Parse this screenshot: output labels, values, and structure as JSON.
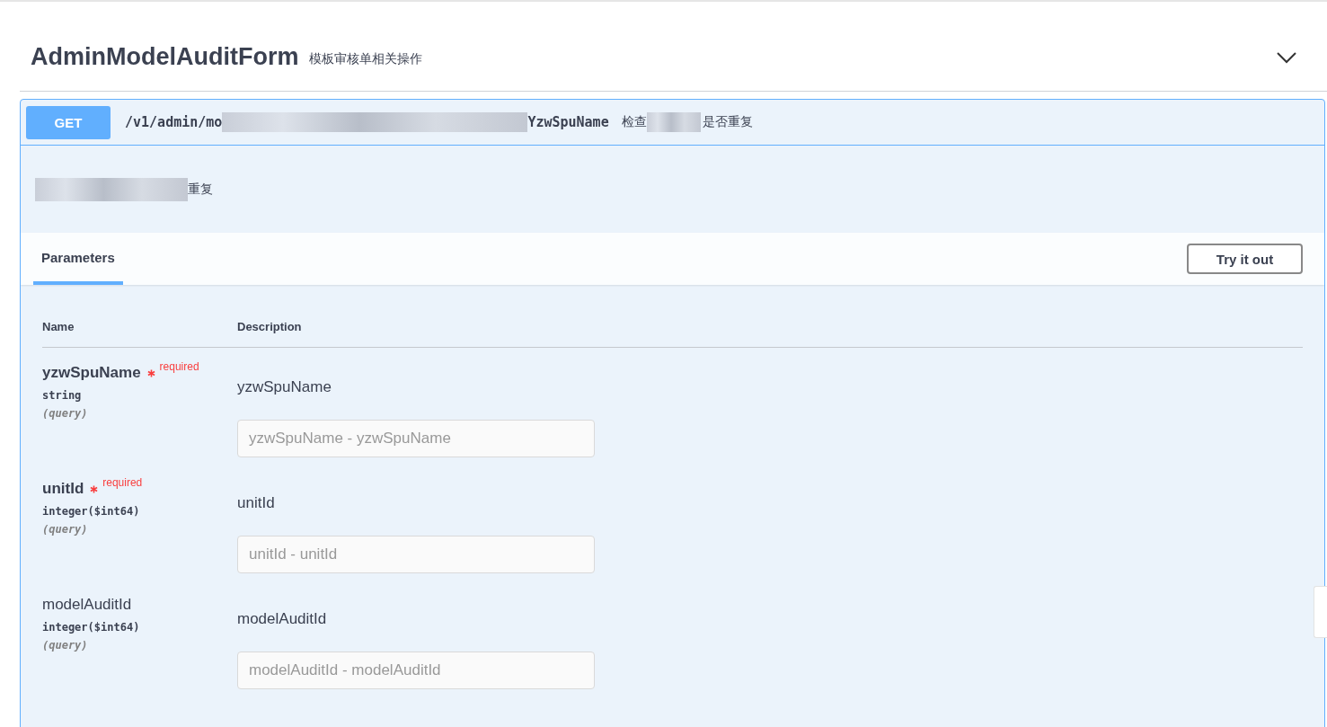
{
  "tag": {
    "name": "AdminModelAuditForm",
    "description": "模板审核单相关操作",
    "expanded": true
  },
  "operation": {
    "method": "GET",
    "path_start": "/v1/admin/mo",
    "path_end": "YzwSpuName",
    "summary_start": "检查",
    "summary_end": "是否重复",
    "description_end": "重复"
  },
  "tabs": [
    {
      "label": "Parameters",
      "selected": true
    }
  ],
  "try_button": "Try it out",
  "columns": [
    "Name",
    "Description"
  ],
  "parameters": [
    {
      "name": "yzwSpuName",
      "required": true,
      "required_label": "required",
      "type": "string",
      "location": "(query)",
      "description": "yzwSpuName",
      "placeholder": "yzwSpuName - yzwSpuName"
    },
    {
      "name": "unitId",
      "required": true,
      "required_label": "required",
      "type": "integer($int64)",
      "location": "(query)",
      "description": "unitId",
      "placeholder": "unitId - unitId"
    },
    {
      "name": "modelAuditId",
      "required": false,
      "type": "integer($int64)",
      "location": "(query)",
      "description": "modelAuditId",
      "placeholder": "modelAuditId - modelAuditId"
    }
  ]
}
